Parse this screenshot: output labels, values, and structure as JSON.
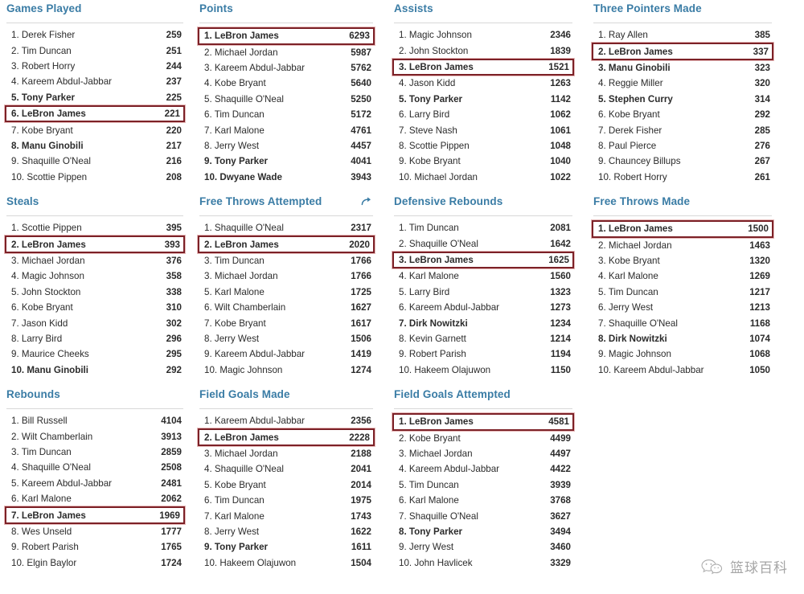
{
  "theme": {
    "header_color": "#3a7ca5",
    "highlight_border": "#7c2127",
    "rule_color": "#d8d8d8",
    "text_color": "#2b2b2b"
  },
  "watermark": {
    "text": "篮球百科",
    "icon": "wechat-bubble-icon"
  },
  "share_icon_name": "share-arrow-icon",
  "panels": [
    {
      "title": "Games Played",
      "has_share": false,
      "rows": [
        {
          "rank": "1.",
          "name": "Derek Fisher",
          "value": "259",
          "bold": false,
          "highlight": false
        },
        {
          "rank": "2.",
          "name": "Tim Duncan",
          "value": "251",
          "bold": false,
          "highlight": false
        },
        {
          "rank": "3.",
          "name": "Robert Horry",
          "value": "244",
          "bold": false,
          "highlight": false
        },
        {
          "rank": "4.",
          "name": "Kareem Abdul-Jabbar",
          "value": "237",
          "bold": false,
          "highlight": false
        },
        {
          "rank": "5.",
          "name": "Tony Parker",
          "value": "225",
          "bold": true,
          "highlight": false
        },
        {
          "rank": "6.",
          "name": "LeBron James",
          "value": "221",
          "bold": true,
          "highlight": true
        },
        {
          "rank": "7.",
          "name": "Kobe Bryant",
          "value": "220",
          "bold": false,
          "highlight": false
        },
        {
          "rank": "8.",
          "name": "Manu Ginobili",
          "value": "217",
          "bold": true,
          "highlight": false
        },
        {
          "rank": "9.",
          "name": "Shaquille O'Neal",
          "value": "216",
          "bold": false,
          "highlight": false
        },
        {
          "rank": "10.",
          "name": "Scottie Pippen",
          "value": "208",
          "bold": false,
          "highlight": false
        }
      ]
    },
    {
      "title": "Points",
      "has_share": false,
      "rows": [
        {
          "rank": "1.",
          "name": "LeBron James",
          "value": "6293",
          "bold": true,
          "highlight": true
        },
        {
          "rank": "2.",
          "name": "Michael Jordan",
          "value": "5987",
          "bold": false,
          "highlight": false
        },
        {
          "rank": "3.",
          "name": "Kareem Abdul-Jabbar",
          "value": "5762",
          "bold": false,
          "highlight": false
        },
        {
          "rank": "4.",
          "name": "Kobe Bryant",
          "value": "5640",
          "bold": false,
          "highlight": false
        },
        {
          "rank": "5.",
          "name": "Shaquille O'Neal",
          "value": "5250",
          "bold": false,
          "highlight": false
        },
        {
          "rank": "6.",
          "name": "Tim Duncan",
          "value": "5172",
          "bold": false,
          "highlight": false
        },
        {
          "rank": "7.",
          "name": "Karl Malone",
          "value": "4761",
          "bold": false,
          "highlight": false
        },
        {
          "rank": "8.",
          "name": "Jerry West",
          "value": "4457",
          "bold": false,
          "highlight": false
        },
        {
          "rank": "9.",
          "name": "Tony Parker",
          "value": "4041",
          "bold": true,
          "highlight": false
        },
        {
          "rank": "10.",
          "name": "Dwyane Wade",
          "value": "3943",
          "bold": true,
          "highlight": false
        }
      ]
    },
    {
      "title": "Assists",
      "has_share": false,
      "rows": [
        {
          "rank": "1.",
          "name": "Magic Johnson",
          "value": "2346",
          "bold": false,
          "highlight": false
        },
        {
          "rank": "2.",
          "name": "John Stockton",
          "value": "1839",
          "bold": false,
          "highlight": false
        },
        {
          "rank": "3.",
          "name": "LeBron James",
          "value": "1521",
          "bold": true,
          "highlight": true
        },
        {
          "rank": "4.",
          "name": "Jason Kidd",
          "value": "1263",
          "bold": false,
          "highlight": false
        },
        {
          "rank": "5.",
          "name": "Tony Parker",
          "value": "1142",
          "bold": true,
          "highlight": false
        },
        {
          "rank": "6.",
          "name": "Larry Bird",
          "value": "1062",
          "bold": false,
          "highlight": false
        },
        {
          "rank": "7.",
          "name": "Steve Nash",
          "value": "1061",
          "bold": false,
          "highlight": false
        },
        {
          "rank": "8.",
          "name": "Scottie Pippen",
          "value": "1048",
          "bold": false,
          "highlight": false
        },
        {
          "rank": "9.",
          "name": "Kobe Bryant",
          "value": "1040",
          "bold": false,
          "highlight": false
        },
        {
          "rank": "10.",
          "name": "Michael Jordan",
          "value": "1022",
          "bold": false,
          "highlight": false
        }
      ]
    },
    {
      "title": "Three Pointers Made",
      "has_share": false,
      "rows": [
        {
          "rank": "1.",
          "name": "Ray Allen",
          "value": "385",
          "bold": false,
          "highlight": false
        },
        {
          "rank": "2.",
          "name": "LeBron James",
          "value": "337",
          "bold": true,
          "highlight": true
        },
        {
          "rank": "3.",
          "name": "Manu Ginobili",
          "value": "323",
          "bold": true,
          "highlight": false
        },
        {
          "rank": "4.",
          "name": "Reggie Miller",
          "value": "320",
          "bold": false,
          "highlight": false
        },
        {
          "rank": "5.",
          "name": "Stephen Curry",
          "value": "314",
          "bold": true,
          "highlight": false
        },
        {
          "rank": "6.",
          "name": "Kobe Bryant",
          "value": "292",
          "bold": false,
          "highlight": false
        },
        {
          "rank": "7.",
          "name": "Derek Fisher",
          "value": "285",
          "bold": false,
          "highlight": false
        },
        {
          "rank": "8.",
          "name": "Paul Pierce",
          "value": "276",
          "bold": false,
          "highlight": false
        },
        {
          "rank": "9.",
          "name": "Chauncey Billups",
          "value": "267",
          "bold": false,
          "highlight": false
        },
        {
          "rank": "10.",
          "name": "Robert Horry",
          "value": "261",
          "bold": false,
          "highlight": false
        }
      ]
    },
    {
      "title": "Steals",
      "has_share": false,
      "rows": [
        {
          "rank": "1.",
          "name": "Scottie Pippen",
          "value": "395",
          "bold": false,
          "highlight": false
        },
        {
          "rank": "2.",
          "name": "LeBron James",
          "value": "393",
          "bold": true,
          "highlight": true
        },
        {
          "rank": "3.",
          "name": "Michael Jordan",
          "value": "376",
          "bold": false,
          "highlight": false
        },
        {
          "rank": "4.",
          "name": "Magic Johnson",
          "value": "358",
          "bold": false,
          "highlight": false
        },
        {
          "rank": "5.",
          "name": "John Stockton",
          "value": "338",
          "bold": false,
          "highlight": false
        },
        {
          "rank": "6.",
          "name": "Kobe Bryant",
          "value": "310",
          "bold": false,
          "highlight": false
        },
        {
          "rank": "7.",
          "name": "Jason Kidd",
          "value": "302",
          "bold": false,
          "highlight": false
        },
        {
          "rank": "8.",
          "name": "Larry Bird",
          "value": "296",
          "bold": false,
          "highlight": false
        },
        {
          "rank": "9.",
          "name": "Maurice Cheeks",
          "value": "295",
          "bold": false,
          "highlight": false
        },
        {
          "rank": "10.",
          "name": "Manu Ginobili",
          "value": "292",
          "bold": true,
          "highlight": false
        }
      ]
    },
    {
      "title": "Free Throws Attempted",
      "has_share": true,
      "rows": [
        {
          "rank": "1.",
          "name": "Shaquille O'Neal",
          "value": "2317",
          "bold": false,
          "highlight": false
        },
        {
          "rank": "2.",
          "name": "LeBron James",
          "value": "2020",
          "bold": true,
          "highlight": true
        },
        {
          "rank": "3.",
          "name": "Tim Duncan",
          "value": "1766",
          "bold": false,
          "highlight": false
        },
        {
          "rank": "3.",
          "name": "Michael Jordan",
          "value": "1766",
          "bold": false,
          "highlight": false
        },
        {
          "rank": "5.",
          "name": "Karl Malone",
          "value": "1725",
          "bold": false,
          "highlight": false
        },
        {
          "rank": "6.",
          "name": "Wilt Chamberlain",
          "value": "1627",
          "bold": false,
          "highlight": false
        },
        {
          "rank": "7.",
          "name": "Kobe Bryant",
          "value": "1617",
          "bold": false,
          "highlight": false
        },
        {
          "rank": "8.",
          "name": "Jerry West",
          "value": "1506",
          "bold": false,
          "highlight": false
        },
        {
          "rank": "9.",
          "name": "Kareem Abdul-Jabbar",
          "value": "1419",
          "bold": false,
          "highlight": false
        },
        {
          "rank": "10.",
          "name": "Magic Johnson",
          "value": "1274",
          "bold": false,
          "highlight": false
        }
      ]
    },
    {
      "title": "Defensive Rebounds",
      "has_share": false,
      "rows": [
        {
          "rank": "1.",
          "name": "Tim Duncan",
          "value": "2081",
          "bold": false,
          "highlight": false
        },
        {
          "rank": "2.",
          "name": "Shaquille O'Neal",
          "value": "1642",
          "bold": false,
          "highlight": false
        },
        {
          "rank": "3.",
          "name": "LeBron James",
          "value": "1625",
          "bold": true,
          "highlight": true
        },
        {
          "rank": "4.",
          "name": "Karl Malone",
          "value": "1560",
          "bold": false,
          "highlight": false
        },
        {
          "rank": "5.",
          "name": "Larry Bird",
          "value": "1323",
          "bold": false,
          "highlight": false
        },
        {
          "rank": "6.",
          "name": "Kareem Abdul-Jabbar",
          "value": "1273",
          "bold": false,
          "highlight": false
        },
        {
          "rank": "7.",
          "name": "Dirk Nowitzki",
          "value": "1234",
          "bold": true,
          "highlight": false
        },
        {
          "rank": "8.",
          "name": "Kevin Garnett",
          "value": "1214",
          "bold": false,
          "highlight": false
        },
        {
          "rank": "9.",
          "name": "Robert Parish",
          "value": "1194",
          "bold": false,
          "highlight": false
        },
        {
          "rank": "10.",
          "name": "Hakeem Olajuwon",
          "value": "1150",
          "bold": false,
          "highlight": false
        }
      ]
    },
    {
      "title": "Free Throws Made",
      "has_share": false,
      "rows": [
        {
          "rank": "1.",
          "name": "LeBron James",
          "value": "1500",
          "bold": true,
          "highlight": true
        },
        {
          "rank": "2.",
          "name": "Michael Jordan",
          "value": "1463",
          "bold": false,
          "highlight": false
        },
        {
          "rank": "3.",
          "name": "Kobe Bryant",
          "value": "1320",
          "bold": false,
          "highlight": false
        },
        {
          "rank": "4.",
          "name": "Karl Malone",
          "value": "1269",
          "bold": false,
          "highlight": false
        },
        {
          "rank": "5.",
          "name": "Tim Duncan",
          "value": "1217",
          "bold": false,
          "highlight": false
        },
        {
          "rank": "6.",
          "name": "Jerry West",
          "value": "1213",
          "bold": false,
          "highlight": false
        },
        {
          "rank": "7.",
          "name": "Shaquille O'Neal",
          "value": "1168",
          "bold": false,
          "highlight": false
        },
        {
          "rank": "8.",
          "name": "Dirk Nowitzki",
          "value": "1074",
          "bold": true,
          "highlight": false
        },
        {
          "rank": "9.",
          "name": "Magic Johnson",
          "value": "1068",
          "bold": false,
          "highlight": false
        },
        {
          "rank": "10.",
          "name": "Kareem Abdul-Jabbar",
          "value": "1050",
          "bold": false,
          "highlight": false
        }
      ]
    },
    {
      "title": "Rebounds",
      "has_share": false,
      "rows": [
        {
          "rank": "1.",
          "name": "Bill Russell",
          "value": "4104",
          "bold": false,
          "highlight": false
        },
        {
          "rank": "2.",
          "name": "Wilt Chamberlain",
          "value": "3913",
          "bold": false,
          "highlight": false
        },
        {
          "rank": "3.",
          "name": "Tim Duncan",
          "value": "2859",
          "bold": false,
          "highlight": false
        },
        {
          "rank": "4.",
          "name": "Shaquille O'Neal",
          "value": "2508",
          "bold": false,
          "highlight": false
        },
        {
          "rank": "5.",
          "name": "Kareem Abdul-Jabbar",
          "value": "2481",
          "bold": false,
          "highlight": false
        },
        {
          "rank": "6.",
          "name": "Karl Malone",
          "value": "2062",
          "bold": false,
          "highlight": false
        },
        {
          "rank": "7.",
          "name": "LeBron James",
          "value": "1969",
          "bold": true,
          "highlight": true
        },
        {
          "rank": "8.",
          "name": "Wes Unseld",
          "value": "1777",
          "bold": false,
          "highlight": false
        },
        {
          "rank": "9.",
          "name": "Robert Parish",
          "value": "1765",
          "bold": false,
          "highlight": false
        },
        {
          "rank": "10.",
          "name": "Elgin Baylor",
          "value": "1724",
          "bold": false,
          "highlight": false
        }
      ]
    },
    {
      "title": "Field Goals Made",
      "has_share": false,
      "rows": [
        {
          "rank": "1.",
          "name": "Kareem Abdul-Jabbar",
          "value": "2356",
          "bold": false,
          "highlight": false
        },
        {
          "rank": "2.",
          "name": "LeBron James",
          "value": "2228",
          "bold": true,
          "highlight": true
        },
        {
          "rank": "3.",
          "name": "Michael Jordan",
          "value": "2188",
          "bold": false,
          "highlight": false
        },
        {
          "rank": "4.",
          "name": "Shaquille O'Neal",
          "value": "2041",
          "bold": false,
          "highlight": false
        },
        {
          "rank": "5.",
          "name": "Kobe Bryant",
          "value": "2014",
          "bold": false,
          "highlight": false
        },
        {
          "rank": "6.",
          "name": "Tim Duncan",
          "value": "1975",
          "bold": false,
          "highlight": false
        },
        {
          "rank": "7.",
          "name": "Karl Malone",
          "value": "1743",
          "bold": false,
          "highlight": false
        },
        {
          "rank": "8.",
          "name": "Jerry West",
          "value": "1622",
          "bold": false,
          "highlight": false
        },
        {
          "rank": "9.",
          "name": "Tony Parker",
          "value": "1611",
          "bold": true,
          "highlight": false
        },
        {
          "rank": "10.",
          "name": "Hakeem Olajuwon",
          "value": "1504",
          "bold": false,
          "highlight": false
        }
      ]
    },
    {
      "title": "Field Goals Attempted",
      "has_share": false,
      "rows": [
        {
          "rank": "1.",
          "name": "LeBron James",
          "value": "4581",
          "bold": true,
          "highlight": true
        },
        {
          "rank": "2.",
          "name": "Kobe Bryant",
          "value": "4499",
          "bold": false,
          "highlight": false
        },
        {
          "rank": "3.",
          "name": "Michael Jordan",
          "value": "4497",
          "bold": false,
          "highlight": false
        },
        {
          "rank": "4.",
          "name": "Kareem Abdul-Jabbar",
          "value": "4422",
          "bold": false,
          "highlight": false
        },
        {
          "rank": "5.",
          "name": "Tim Duncan",
          "value": "3939",
          "bold": false,
          "highlight": false
        },
        {
          "rank": "6.",
          "name": "Karl Malone",
          "value": "3768",
          "bold": false,
          "highlight": false
        },
        {
          "rank": "7.",
          "name": "Shaquille O'Neal",
          "value": "3627",
          "bold": false,
          "highlight": false
        },
        {
          "rank": "8.",
          "name": "Tony Parker",
          "value": "3494",
          "bold": true,
          "highlight": false
        },
        {
          "rank": "9.",
          "name": "Jerry West",
          "value": "3460",
          "bold": false,
          "highlight": false
        },
        {
          "rank": "10.",
          "name": "John Havlicek",
          "value": "3329",
          "bold": false,
          "highlight": false
        }
      ]
    }
  ]
}
